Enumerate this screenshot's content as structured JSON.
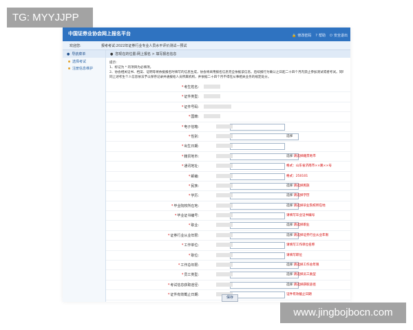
{
  "app": {
    "brand": "中国证券业协会网上报名平台"
  },
  "topbar": {
    "tools": [
      {
        "icon": "lock-icon",
        "label": "修改密码"
      },
      {
        "icon": "help-icon",
        "label": "帮助"
      },
      {
        "icon": "exit-icon",
        "label": "安全退出"
      }
    ]
  },
  "infobar": {
    "welcome": "欢迎您:",
    "exam": "报考考试:2022年证券行业专业人员水平评价测试—预试"
  },
  "sidebar": {
    "title": "导航菜单",
    "items": [
      {
        "label": "选择考试"
      },
      {
        "label": "注册信息维护"
      }
    ]
  },
  "breadcrumb": "您现在的位置:网上报名 > 填写报名信息",
  "notice": {
    "title": "提示:",
    "lines": [
      "1、标记为 * 的项目为必填项。",
      "2、协会相关证书、档案、证明等将依据报名时填写的信息生成，协会将采用报名信息完全依据该信息。后续报行为确认之日起二十四个月内禁止参加测试或者考试。同时，协会将",
      "同上述考生个人信息依法予以保存记录并通报给人员所属机构，并依据二十四个月不得在从事相关业务的规定处分。"
    ]
  },
  "form": {
    "rows": [
      {
        "label": "考生姓名:",
        "req": true
      },
      {
        "label": "证件类型:",
        "req": true
      },
      {
        "label": "证件号码:",
        "req": true
      },
      {
        "label": "国籍:",
        "req": true
      },
      {
        "label": "电子信箱:",
        "req": true,
        "input": "text"
      },
      {
        "label": "性别:",
        "req": true,
        "input": "text",
        "hint": "选择"
      },
      {
        "label": "出生日期:",
        "req": true,
        "input": "text"
      },
      {
        "label": "籍贯地市:",
        "req": true,
        "input": "text",
        "hint": "选择",
        "hint_red": "请选择籍贯地市"
      },
      {
        "label": "通讯地址:",
        "req": true,
        "input": "text",
        "hint_red": "格式：山东省济南市××路××号"
      },
      {
        "label": "邮编:",
        "req": true,
        "input": "text",
        "hint_red": "格式：250101"
      },
      {
        "label": "民族:",
        "req": true,
        "input": "text",
        "hint": "选择",
        "hint_red": "请选择民族"
      },
      {
        "label": "学历:",
        "req": true,
        "input": "text",
        "hint": "选择",
        "hint_red": "请选择学历"
      },
      {
        "label": "毕业院校所在地:",
        "req": true,
        "input": "text",
        "hint": "选择",
        "hint_red": "请选择毕业院校所在地"
      },
      {
        "label": "毕业证书编号:",
        "req": true,
        "input": "text",
        "hint_red": "请填写毕业证书编号"
      },
      {
        "label": "职业:",
        "req": true,
        "input": "text",
        "hint": "选择",
        "hint_red": "请选择职业"
      },
      {
        "label": "证券行业从业年限:",
        "req": true,
        "input": "text",
        "hint": "选择",
        "hint_red": "请选择证券行业从业年限"
      },
      {
        "label": "工作单位:",
        "req": true,
        "input": "text",
        "hint_red": "请填写工作单位名称"
      },
      {
        "label": "职位:",
        "req": true,
        "input": "text",
        "hint_red": "请填写职位"
      },
      {
        "label": "工作总年限:",
        "req": true,
        "input": "text",
        "hint": "选择",
        "hint_red": "请选择工作总年限"
      },
      {
        "label": "员工类型:",
        "req": true,
        "input": "text",
        "hint": "选择",
        "hint_red": "请选择员工类型"
      },
      {
        "label": "考试信息获取途径:",
        "req": true,
        "input": "text",
        "hint": "选择",
        "hint_red": "请选择获取途径"
      },
      {
        "label": "证件有效截止日期:",
        "req": true,
        "input": "text",
        "hint_red": "证件有效截止日期"
      }
    ],
    "save_label": "保存"
  },
  "watermarks": {
    "top_left": "TG: MYYJJPP",
    "bottom_right": "www.jingbojbocn.com"
  }
}
